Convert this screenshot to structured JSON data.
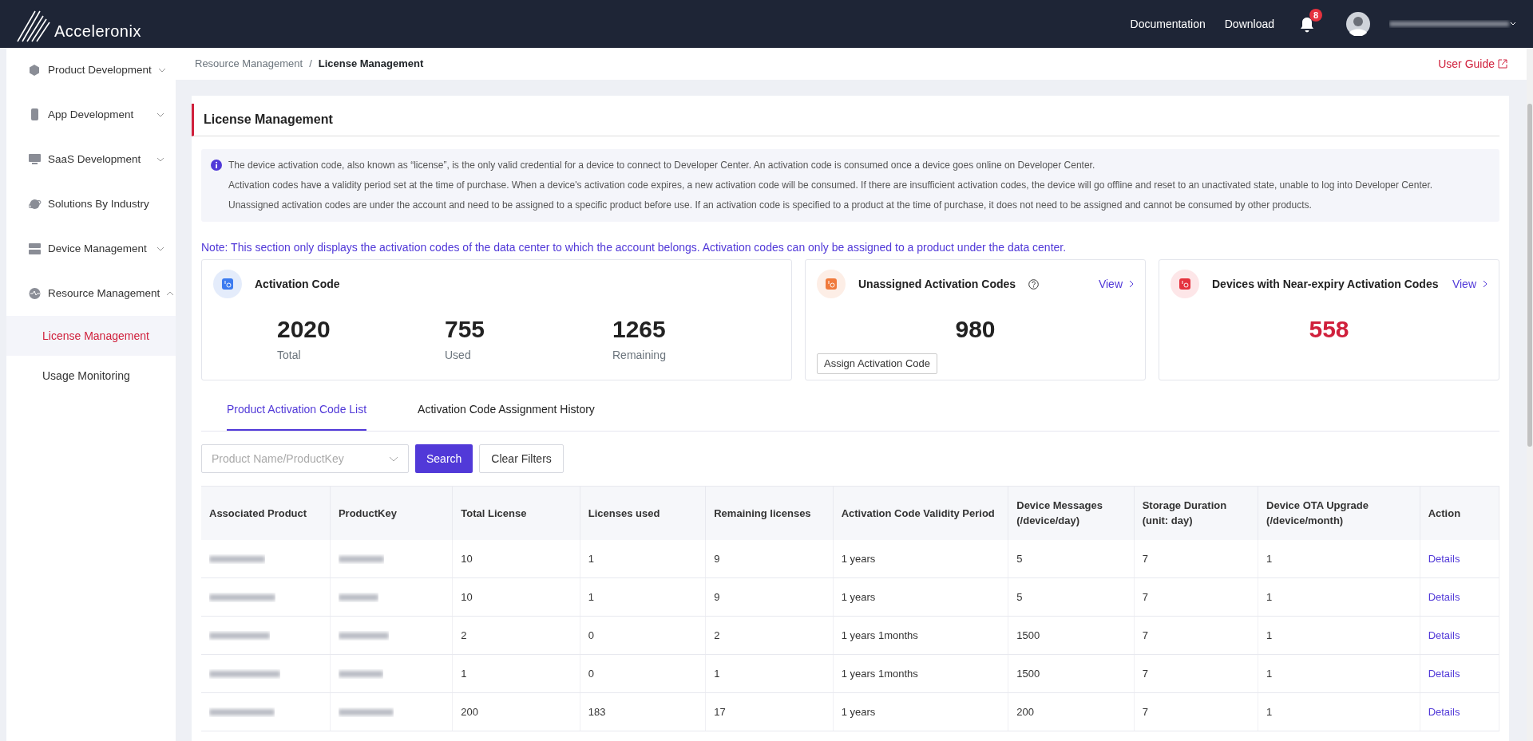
{
  "header": {
    "logo_text": "Acceleronix",
    "nav_links": [
      "Documentation",
      "Download"
    ],
    "notification_count": "8"
  },
  "sidebar": {
    "items": [
      {
        "label": "Product Development",
        "expanded": false
      },
      {
        "label": "App Development",
        "expanded": false
      },
      {
        "label": "SaaS Development",
        "expanded": false
      },
      {
        "label": "Solutions By Industry"
      },
      {
        "label": "Device Management",
        "expanded": false
      },
      {
        "label": "Resource Management",
        "expanded": true,
        "children": [
          {
            "label": "License Management",
            "selected": true
          },
          {
            "label": "Usage Monitoring",
            "selected": false
          }
        ]
      }
    ]
  },
  "breadcrumb": [
    "Resource Management",
    "License Management"
  ],
  "breadcrumb_separator": "/",
  "user_guide": "User Guide",
  "panel": {
    "title": "License Management",
    "info_lines": [
      "The device activation code, also known as “license”, is the only valid credential for a device to connect to Developer Center. An activation code is consumed once a device goes online on Developer Center.",
      "Activation codes have a validity period set at the time of purchase. When a device's activation code expires, a new activation code will be consumed. If there are insufficient activation codes, the device will go offline and reset to an unactivated state, unable to log into Developer Center.",
      "Unassigned activation codes are under the account and need to be assigned to a specific product before use. If an activation code is specified to a product at the time of purchase, it does not need to be assigned and cannot be consumed by other products."
    ],
    "note": "Note: This section only displays the activation codes of the data center to which the account belongs. Activation codes can only be assigned to a product under the data center.",
    "cards": [
      {
        "kind": "summary",
        "title": "Activation Code",
        "metrics": [
          {
            "value": "2020",
            "label": "Total"
          },
          {
            "value": "755",
            "label": "Used"
          },
          {
            "value": "1265",
            "label": "Remaining"
          }
        ]
      },
      {
        "kind": "unassigned",
        "title": "Unassigned Activation Codes",
        "link": "View",
        "value": "980",
        "button": "Assign Activation Code"
      },
      {
        "kind": "expiry",
        "title": "Devices with Near-expiry Activation Codes",
        "link": "View",
        "value": "558"
      }
    ],
    "tabs": [
      {
        "label": "Product Activation Code List",
        "selected": true
      },
      {
        "label": "Activation Code Assignment History",
        "selected": false
      }
    ],
    "filter": {
      "placeholder": "Product Name/ProductKey",
      "search": "Search",
      "clear": "Clear Filters"
    },
    "table": {
      "columns": [
        "Associated Product",
        "ProductKey",
        "Total License",
        "Licenses used",
        "Remaining licenses",
        "Activation Code Validity Period",
        "Device Messages (/device/day)",
        "Storage Duration (unit: day)",
        "Device OTA Upgrade (/device/month)",
        "Action"
      ],
      "rows": [
        {
          "total": "10",
          "used": "1",
          "remaining": "9",
          "validity": "1 years",
          "messages": "5",
          "storage": "7",
          "ota": "1",
          "action": "Details"
        },
        {
          "total": "10",
          "used": "1",
          "remaining": "9",
          "validity": "1 years",
          "messages": "5",
          "storage": "7",
          "ota": "1",
          "action": "Details"
        },
        {
          "total": "2",
          "used": "0",
          "remaining": "2",
          "validity": "1 years 1months",
          "messages": "1500",
          "storage": "7",
          "ota": "1",
          "action": "Details"
        },
        {
          "total": "1",
          "used": "0",
          "remaining": "1",
          "validity": "1 years 1months",
          "messages": "1500",
          "storage": "7",
          "ota": "1",
          "action": "Details"
        },
        {
          "total": "200",
          "used": "183",
          "remaining": "17",
          "validity": "1 years",
          "messages": "200",
          "storage": "7",
          "ota": "1",
          "action": "Details"
        }
      ]
    }
  }
}
